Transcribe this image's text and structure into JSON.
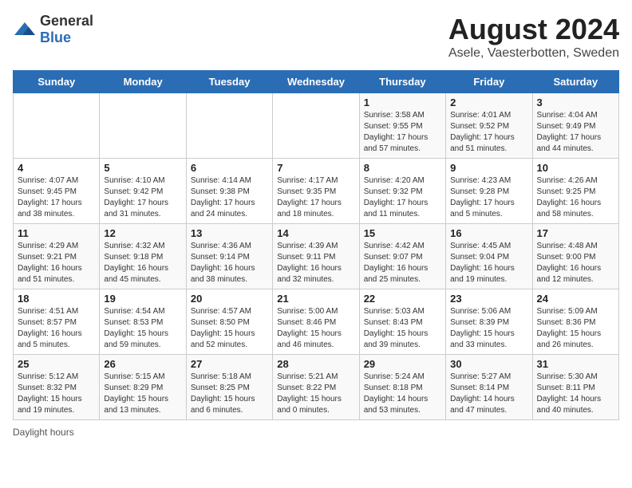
{
  "header": {
    "logo_general": "General",
    "logo_blue": "Blue",
    "month_title": "August 2024",
    "location": "Asele, Vaesterbotten, Sweden"
  },
  "days_of_week": [
    "Sunday",
    "Monday",
    "Tuesday",
    "Wednesday",
    "Thursday",
    "Friday",
    "Saturday"
  ],
  "weeks": [
    [
      {
        "day": "",
        "info": ""
      },
      {
        "day": "",
        "info": ""
      },
      {
        "day": "",
        "info": ""
      },
      {
        "day": "",
        "info": ""
      },
      {
        "day": "1",
        "info": "Sunrise: 3:58 AM\nSunset: 9:55 PM\nDaylight: 17 hours\nand 57 minutes."
      },
      {
        "day": "2",
        "info": "Sunrise: 4:01 AM\nSunset: 9:52 PM\nDaylight: 17 hours\nand 51 minutes."
      },
      {
        "day": "3",
        "info": "Sunrise: 4:04 AM\nSunset: 9:49 PM\nDaylight: 17 hours\nand 44 minutes."
      }
    ],
    [
      {
        "day": "4",
        "info": "Sunrise: 4:07 AM\nSunset: 9:45 PM\nDaylight: 17 hours\nand 38 minutes."
      },
      {
        "day": "5",
        "info": "Sunrise: 4:10 AM\nSunset: 9:42 PM\nDaylight: 17 hours\nand 31 minutes."
      },
      {
        "day": "6",
        "info": "Sunrise: 4:14 AM\nSunset: 9:38 PM\nDaylight: 17 hours\nand 24 minutes."
      },
      {
        "day": "7",
        "info": "Sunrise: 4:17 AM\nSunset: 9:35 PM\nDaylight: 17 hours\nand 18 minutes."
      },
      {
        "day": "8",
        "info": "Sunrise: 4:20 AM\nSunset: 9:32 PM\nDaylight: 17 hours\nand 11 minutes."
      },
      {
        "day": "9",
        "info": "Sunrise: 4:23 AM\nSunset: 9:28 PM\nDaylight: 17 hours\nand 5 minutes."
      },
      {
        "day": "10",
        "info": "Sunrise: 4:26 AM\nSunset: 9:25 PM\nDaylight: 16 hours\nand 58 minutes."
      }
    ],
    [
      {
        "day": "11",
        "info": "Sunrise: 4:29 AM\nSunset: 9:21 PM\nDaylight: 16 hours\nand 51 minutes."
      },
      {
        "day": "12",
        "info": "Sunrise: 4:32 AM\nSunset: 9:18 PM\nDaylight: 16 hours\nand 45 minutes."
      },
      {
        "day": "13",
        "info": "Sunrise: 4:36 AM\nSunset: 9:14 PM\nDaylight: 16 hours\nand 38 minutes."
      },
      {
        "day": "14",
        "info": "Sunrise: 4:39 AM\nSunset: 9:11 PM\nDaylight: 16 hours\nand 32 minutes."
      },
      {
        "day": "15",
        "info": "Sunrise: 4:42 AM\nSunset: 9:07 PM\nDaylight: 16 hours\nand 25 minutes."
      },
      {
        "day": "16",
        "info": "Sunrise: 4:45 AM\nSunset: 9:04 PM\nDaylight: 16 hours\nand 19 minutes."
      },
      {
        "day": "17",
        "info": "Sunrise: 4:48 AM\nSunset: 9:00 PM\nDaylight: 16 hours\nand 12 minutes."
      }
    ],
    [
      {
        "day": "18",
        "info": "Sunrise: 4:51 AM\nSunset: 8:57 PM\nDaylight: 16 hours\nand 5 minutes."
      },
      {
        "day": "19",
        "info": "Sunrise: 4:54 AM\nSunset: 8:53 PM\nDaylight: 15 hours\nand 59 minutes."
      },
      {
        "day": "20",
        "info": "Sunrise: 4:57 AM\nSunset: 8:50 PM\nDaylight: 15 hours\nand 52 minutes."
      },
      {
        "day": "21",
        "info": "Sunrise: 5:00 AM\nSunset: 8:46 PM\nDaylight: 15 hours\nand 46 minutes."
      },
      {
        "day": "22",
        "info": "Sunrise: 5:03 AM\nSunset: 8:43 PM\nDaylight: 15 hours\nand 39 minutes."
      },
      {
        "day": "23",
        "info": "Sunrise: 5:06 AM\nSunset: 8:39 PM\nDaylight: 15 hours\nand 33 minutes."
      },
      {
        "day": "24",
        "info": "Sunrise: 5:09 AM\nSunset: 8:36 PM\nDaylight: 15 hours\nand 26 minutes."
      }
    ],
    [
      {
        "day": "25",
        "info": "Sunrise: 5:12 AM\nSunset: 8:32 PM\nDaylight: 15 hours\nand 19 minutes."
      },
      {
        "day": "26",
        "info": "Sunrise: 5:15 AM\nSunset: 8:29 PM\nDaylight: 15 hours\nand 13 minutes."
      },
      {
        "day": "27",
        "info": "Sunrise: 5:18 AM\nSunset: 8:25 PM\nDaylight: 15 hours\nand 6 minutes."
      },
      {
        "day": "28",
        "info": "Sunrise: 5:21 AM\nSunset: 8:22 PM\nDaylight: 15 hours\nand 0 minutes."
      },
      {
        "day": "29",
        "info": "Sunrise: 5:24 AM\nSunset: 8:18 PM\nDaylight: 14 hours\nand 53 minutes."
      },
      {
        "day": "30",
        "info": "Sunrise: 5:27 AM\nSunset: 8:14 PM\nDaylight: 14 hours\nand 47 minutes."
      },
      {
        "day": "31",
        "info": "Sunrise: 5:30 AM\nSunset: 8:11 PM\nDaylight: 14 hours\nand 40 minutes."
      }
    ]
  ],
  "footer": {
    "note": "Daylight hours"
  }
}
